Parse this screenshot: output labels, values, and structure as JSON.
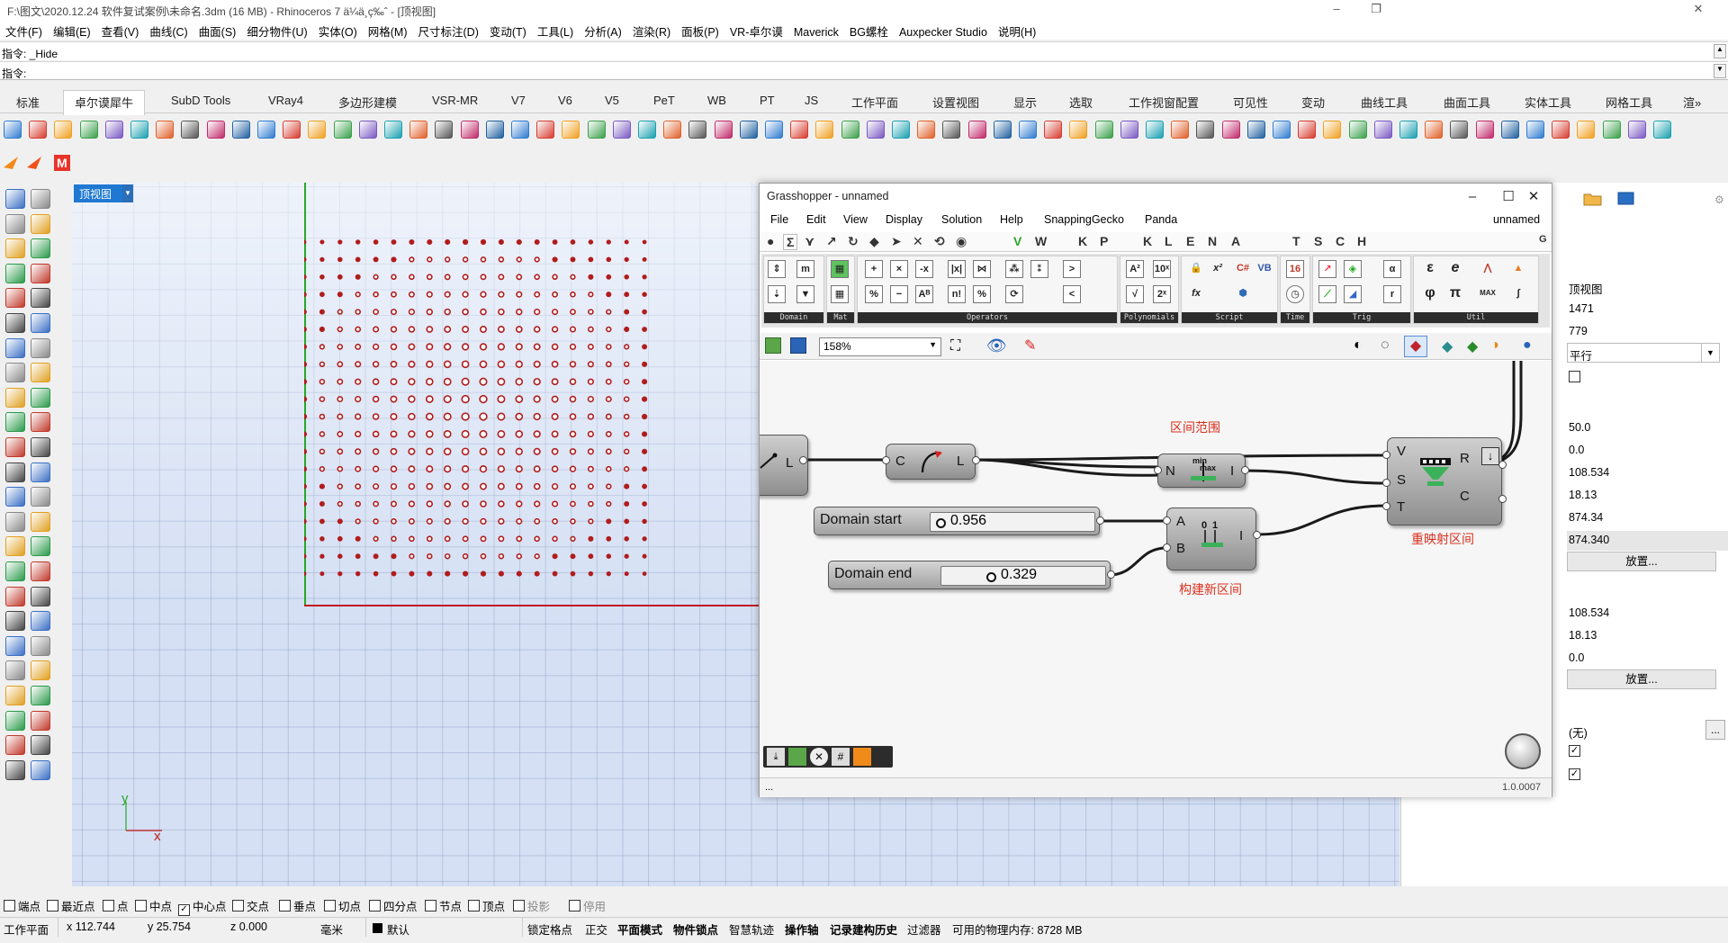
{
  "window": {
    "title": "F:\\图文\\2020.12.24 软件复试案例\\未命名.3dm (16 MB) - Rhinoceros 7 ä¼ä¸ç‰ˆ - [顶视图]"
  },
  "menu": [
    "文件(F)",
    "编辑(E)",
    "查看(V)",
    "曲线(C)",
    "曲面(S)",
    "细分物件(U)",
    "实体(O)",
    "网格(M)",
    "尺寸标注(D)",
    "变动(T)",
    "工具(L)",
    "分析(A)",
    "渲染(R)",
    "面板(P)",
    "VR-卓尔谟",
    "Maverick",
    "BG螺栓",
    "Auxpecker Studio",
    "说明(H)"
  ],
  "command": {
    "history": "指令: _Hide",
    "prompt": "指令:"
  },
  "tabs": [
    {
      "label": "标准",
      "active": false
    },
    {
      "label": "卓尔谟犀牛",
      "active": true
    },
    {
      "label": "SubD Tools",
      "active": false
    },
    {
      "label": "VRay4",
      "active": false
    },
    {
      "label": "多边形建模",
      "active": false
    },
    {
      "label": "VSR-MR",
      "active": false
    },
    {
      "label": "V7",
      "active": false
    },
    {
      "label": "V6",
      "active": false
    },
    {
      "label": "V5",
      "active": false
    },
    {
      "label": "PeT",
      "active": false
    },
    {
      "label": "WB",
      "active": false
    },
    {
      "label": "PT",
      "active": false
    },
    {
      "label": "JS",
      "active": false
    },
    {
      "label": "工作平面",
      "active": false
    },
    {
      "label": "设置视图",
      "active": false
    },
    {
      "label": "显示",
      "active": false
    },
    {
      "label": "选取",
      "active": false
    },
    {
      "label": "工作视窗配置",
      "active": false
    },
    {
      "label": "可见性",
      "active": false
    },
    {
      "label": "变动",
      "active": false
    },
    {
      "label": "曲线工具",
      "active": false
    },
    {
      "label": "曲面工具",
      "active": false
    },
    {
      "label": "实体工具",
      "active": false
    },
    {
      "label": "网格工具",
      "active": false
    },
    {
      "label": "渲»",
      "active": false
    }
  ],
  "viewport": {
    "label": "顶视图",
    "axis_x": "x",
    "axis_y": "y",
    "colors": {
      "x_axis": "#c31818",
      "y_axis": "#27a827",
      "points": "#b01d1d"
    }
  },
  "properties": {
    "view_name": "顶视图",
    "width": "1471",
    "height": "779",
    "projection": "平行",
    "lens": "50.0",
    "rotation": "0.0",
    "location_x": "108.534",
    "location_y": "18.13",
    "distance": "874.34",
    "distance_selected": "874.340",
    "place_button": "放置...",
    "target_x": "108.534",
    "target_y": "18.13",
    "target_z": "0.0",
    "place_button2": "放置...",
    "wallpaper": "(无)",
    "more_button": "..."
  },
  "osnap": [
    {
      "label": "端点",
      "checked": false,
      "enabled": true
    },
    {
      "label": "最近点",
      "checked": false,
      "enabled": true
    },
    {
      "label": "点",
      "checked": false,
      "enabled": true
    },
    {
      "label": "中点",
      "checked": false,
      "enabled": true
    },
    {
      "label": "中心点",
      "checked": true,
      "enabled": true
    },
    {
      "label": "交点",
      "checked": false,
      "enabled": true
    },
    {
      "label": "垂点",
      "checked": false,
      "enabled": true
    },
    {
      "label": "切点",
      "checked": false,
      "enabled": true
    },
    {
      "label": "四分点",
      "checked": false,
      "enabled": true
    },
    {
      "label": "节点",
      "checked": false,
      "enabled": true
    },
    {
      "label": "顶点",
      "checked": false,
      "enabled": true
    },
    {
      "label": "投影",
      "checked": false,
      "enabled": false
    },
    {
      "label": "停用",
      "checked": false,
      "enabled": false
    }
  ],
  "status": {
    "cplane": "工作平面",
    "x": "x 112.744",
    "y": "y 25.754",
    "z": "z 0.000",
    "unit": "毫米",
    "layer": "默认",
    "grid_snap": "锁定格点",
    "ortho": "正交",
    "planar": "平面模式",
    "osnap": "物件锁点",
    "smarttrack": "智慧轨迹",
    "gumball": "操作轴",
    "history": "记录建构历史",
    "filter": "过滤器",
    "memory": "可用的物理内存: 8728 MB"
  },
  "grasshopper": {
    "title": "Grasshopper - unnamed",
    "menu": [
      "File",
      "Edit",
      "View",
      "Display",
      "Solution",
      "Help",
      "SnappingGecko",
      "Panda"
    ],
    "doc_name": "unnamed",
    "tab_letters": [
      "V",
      "W",
      "K",
      "P",
      "K",
      "L",
      "E",
      "N",
      "A",
      "T",
      "S",
      "C",
      "H",
      "G"
    ],
    "ribbon_groups": [
      "Domain",
      "Mat",
      "Operators",
      "Polynomials",
      "Script",
      "Time",
      "Trig",
      "Util"
    ],
    "zoom": "158%",
    "version": "1.0.0007",
    "status_text": "...",
    "components": {
      "list_output": "L",
      "curve": {
        "input": "C",
        "output": "L"
      },
      "bounds": {
        "input": "N",
        "output": "I"
      },
      "construct_domain": {
        "input_a": "A",
        "input_b": "B",
        "output": "I"
      },
      "remap": {
        "input_v": "V",
        "input_s": "S",
        "input_t": "T",
        "output_r": "R",
        "output_c": "C"
      }
    },
    "labels": {
      "bounds": "区间范围",
      "construct_domain": "构建新区间",
      "remap": "重映射区间"
    },
    "sliders": [
      {
        "name": "Domain start",
        "value": "0.956"
      },
      {
        "name": "Domain end",
        "value": "0.329"
      }
    ]
  }
}
